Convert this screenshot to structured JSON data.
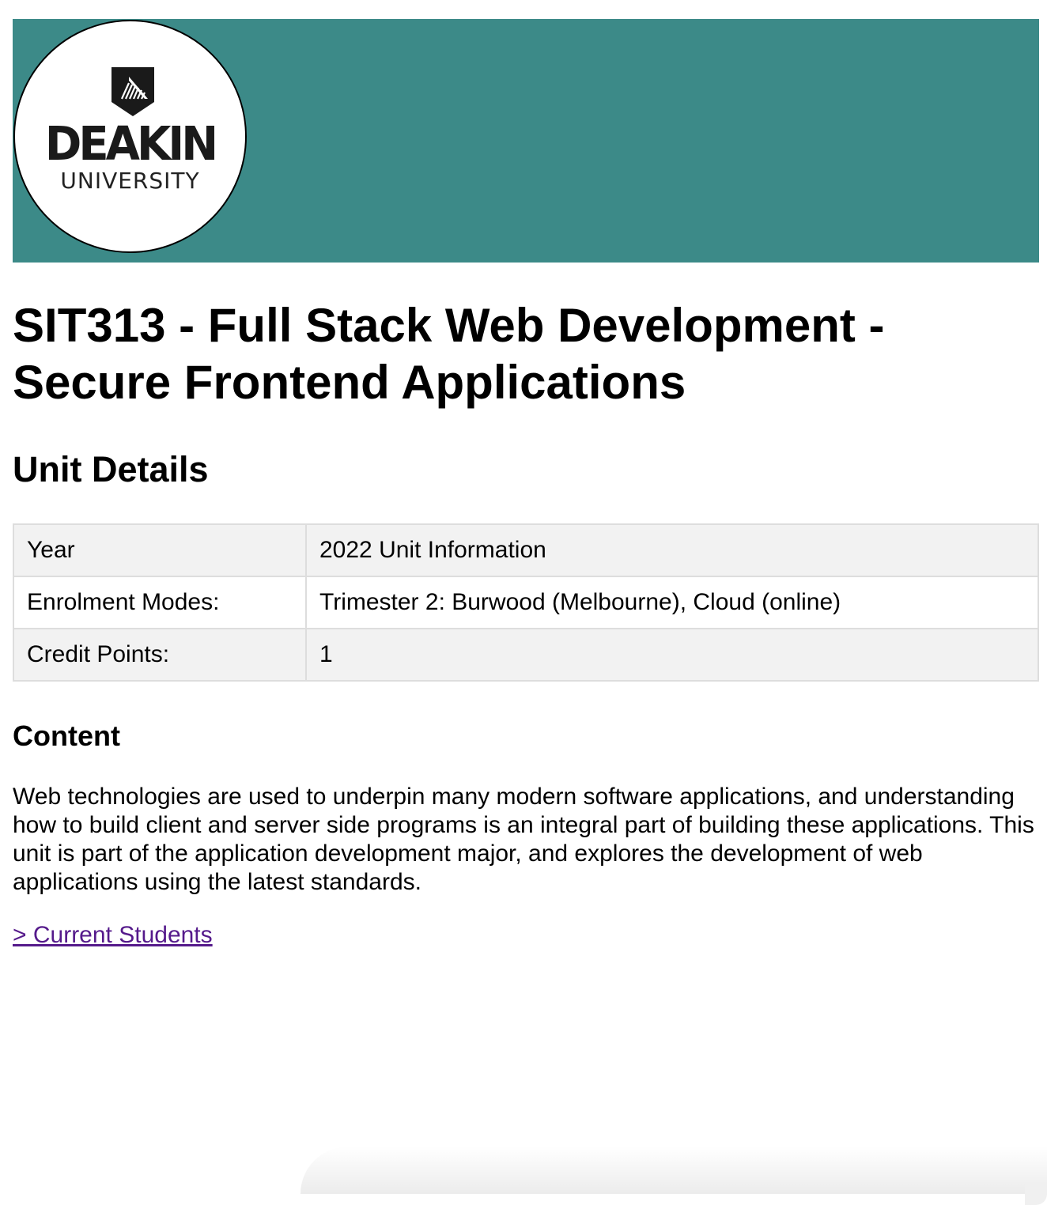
{
  "banner": {
    "background_color": "#3c8a88",
    "logo": {
      "name": "DEAKIN",
      "sub": "UNIVERSITY",
      "icon": "deakin-shield-icon"
    }
  },
  "unit": {
    "title": "SIT313 - Full Stack Web Development - Secure Frontend Applications"
  },
  "unit_details": {
    "heading": "Unit Details",
    "rows": [
      {
        "label": "Year",
        "value": "2022 Unit Information"
      },
      {
        "label": "Enrolment Modes:",
        "value": "Trimester 2: Burwood (Melbourne), Cloud (online)"
      },
      {
        "label": "Credit Points:",
        "value": "1"
      }
    ]
  },
  "content": {
    "heading": "Content",
    "text": "Web technologies are used to underpin many modern software applications, and understanding how to build client and server side programs is an integral part of building these applications. This unit is part of the application development major, and explores the development of web applications using the latest standards."
  },
  "links": {
    "current_students": "> Current Students",
    "link_color": "#551a8b"
  }
}
